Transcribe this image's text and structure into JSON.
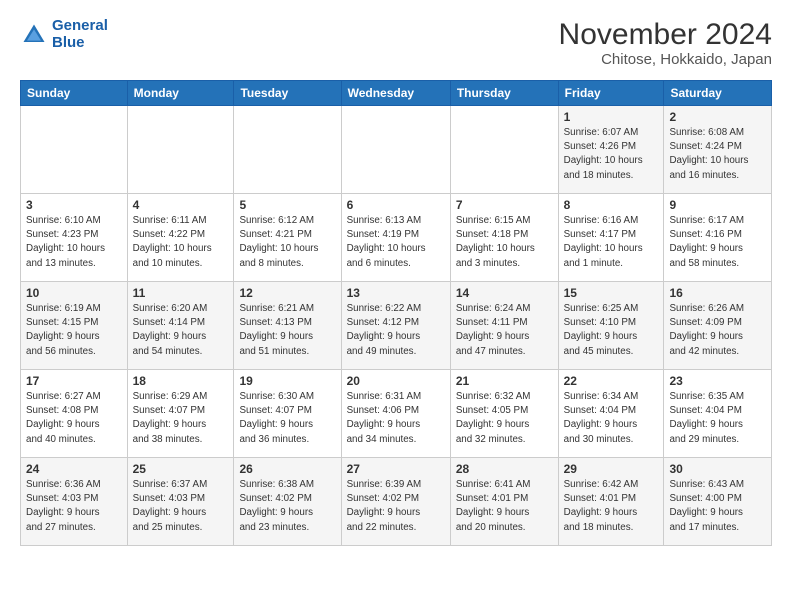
{
  "header": {
    "logo_line1": "General",
    "logo_line2": "Blue",
    "title": "November 2024",
    "subtitle": "Chitose, Hokkaido, Japan"
  },
  "days_of_week": [
    "Sunday",
    "Monday",
    "Tuesday",
    "Wednesday",
    "Thursday",
    "Friday",
    "Saturday"
  ],
  "weeks": [
    [
      {
        "day": "",
        "info": ""
      },
      {
        "day": "",
        "info": ""
      },
      {
        "day": "",
        "info": ""
      },
      {
        "day": "",
        "info": ""
      },
      {
        "day": "",
        "info": ""
      },
      {
        "day": "1",
        "info": "Sunrise: 6:07 AM\nSunset: 4:26 PM\nDaylight: 10 hours\nand 18 minutes."
      },
      {
        "day": "2",
        "info": "Sunrise: 6:08 AM\nSunset: 4:24 PM\nDaylight: 10 hours\nand 16 minutes."
      }
    ],
    [
      {
        "day": "3",
        "info": "Sunrise: 6:10 AM\nSunset: 4:23 PM\nDaylight: 10 hours\nand 13 minutes."
      },
      {
        "day": "4",
        "info": "Sunrise: 6:11 AM\nSunset: 4:22 PM\nDaylight: 10 hours\nand 10 minutes."
      },
      {
        "day": "5",
        "info": "Sunrise: 6:12 AM\nSunset: 4:21 PM\nDaylight: 10 hours\nand 8 minutes."
      },
      {
        "day": "6",
        "info": "Sunrise: 6:13 AM\nSunset: 4:19 PM\nDaylight: 10 hours\nand 6 minutes."
      },
      {
        "day": "7",
        "info": "Sunrise: 6:15 AM\nSunset: 4:18 PM\nDaylight: 10 hours\nand 3 minutes."
      },
      {
        "day": "8",
        "info": "Sunrise: 6:16 AM\nSunset: 4:17 PM\nDaylight: 10 hours\nand 1 minute."
      },
      {
        "day": "9",
        "info": "Sunrise: 6:17 AM\nSunset: 4:16 PM\nDaylight: 9 hours\nand 58 minutes."
      }
    ],
    [
      {
        "day": "10",
        "info": "Sunrise: 6:19 AM\nSunset: 4:15 PM\nDaylight: 9 hours\nand 56 minutes."
      },
      {
        "day": "11",
        "info": "Sunrise: 6:20 AM\nSunset: 4:14 PM\nDaylight: 9 hours\nand 54 minutes."
      },
      {
        "day": "12",
        "info": "Sunrise: 6:21 AM\nSunset: 4:13 PM\nDaylight: 9 hours\nand 51 minutes."
      },
      {
        "day": "13",
        "info": "Sunrise: 6:22 AM\nSunset: 4:12 PM\nDaylight: 9 hours\nand 49 minutes."
      },
      {
        "day": "14",
        "info": "Sunrise: 6:24 AM\nSunset: 4:11 PM\nDaylight: 9 hours\nand 47 minutes."
      },
      {
        "day": "15",
        "info": "Sunrise: 6:25 AM\nSunset: 4:10 PM\nDaylight: 9 hours\nand 45 minutes."
      },
      {
        "day": "16",
        "info": "Sunrise: 6:26 AM\nSunset: 4:09 PM\nDaylight: 9 hours\nand 42 minutes."
      }
    ],
    [
      {
        "day": "17",
        "info": "Sunrise: 6:27 AM\nSunset: 4:08 PM\nDaylight: 9 hours\nand 40 minutes."
      },
      {
        "day": "18",
        "info": "Sunrise: 6:29 AM\nSunset: 4:07 PM\nDaylight: 9 hours\nand 38 minutes."
      },
      {
        "day": "19",
        "info": "Sunrise: 6:30 AM\nSunset: 4:07 PM\nDaylight: 9 hours\nand 36 minutes."
      },
      {
        "day": "20",
        "info": "Sunrise: 6:31 AM\nSunset: 4:06 PM\nDaylight: 9 hours\nand 34 minutes."
      },
      {
        "day": "21",
        "info": "Sunrise: 6:32 AM\nSunset: 4:05 PM\nDaylight: 9 hours\nand 32 minutes."
      },
      {
        "day": "22",
        "info": "Sunrise: 6:34 AM\nSunset: 4:04 PM\nDaylight: 9 hours\nand 30 minutes."
      },
      {
        "day": "23",
        "info": "Sunrise: 6:35 AM\nSunset: 4:04 PM\nDaylight: 9 hours\nand 29 minutes."
      }
    ],
    [
      {
        "day": "24",
        "info": "Sunrise: 6:36 AM\nSunset: 4:03 PM\nDaylight: 9 hours\nand 27 minutes."
      },
      {
        "day": "25",
        "info": "Sunrise: 6:37 AM\nSunset: 4:03 PM\nDaylight: 9 hours\nand 25 minutes."
      },
      {
        "day": "26",
        "info": "Sunrise: 6:38 AM\nSunset: 4:02 PM\nDaylight: 9 hours\nand 23 minutes."
      },
      {
        "day": "27",
        "info": "Sunrise: 6:39 AM\nSunset: 4:02 PM\nDaylight: 9 hours\nand 22 minutes."
      },
      {
        "day": "28",
        "info": "Sunrise: 6:41 AM\nSunset: 4:01 PM\nDaylight: 9 hours\nand 20 minutes."
      },
      {
        "day": "29",
        "info": "Sunrise: 6:42 AM\nSunset: 4:01 PM\nDaylight: 9 hours\nand 18 minutes."
      },
      {
        "day": "30",
        "info": "Sunrise: 6:43 AM\nSunset: 4:00 PM\nDaylight: 9 hours\nand 17 minutes."
      }
    ]
  ]
}
